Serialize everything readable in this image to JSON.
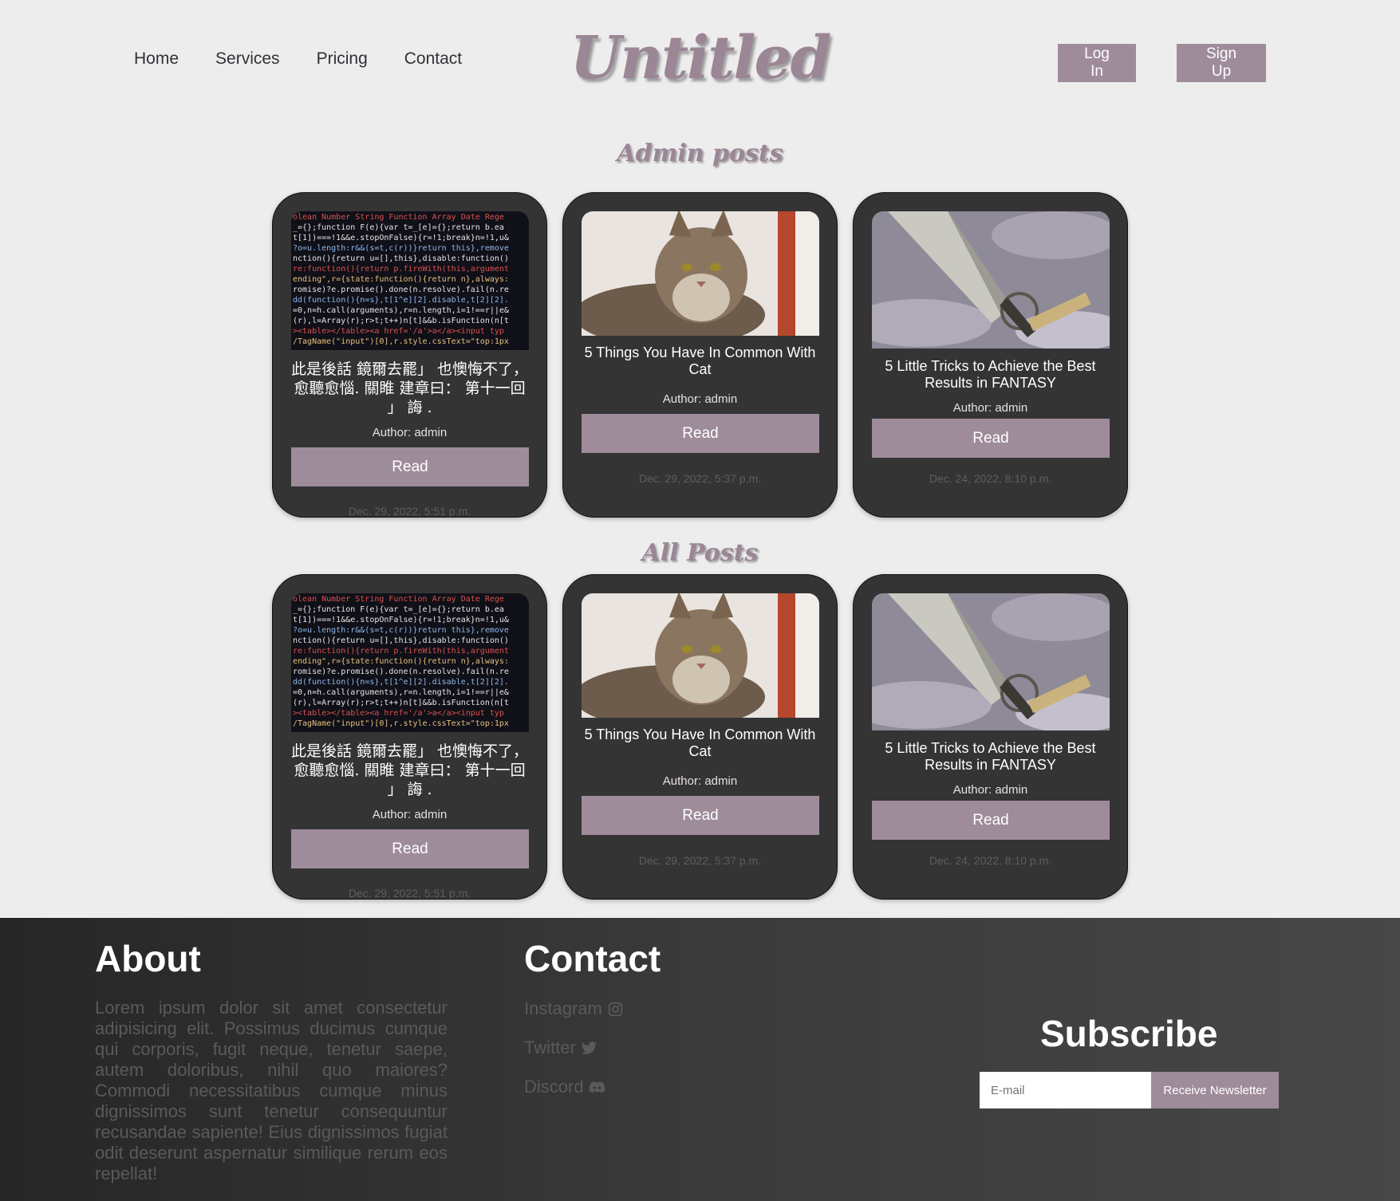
{
  "nav": {
    "home": "Home",
    "services": "Services",
    "pricing": "Pricing",
    "contact": "Contact"
  },
  "logo": "Untitled",
  "auth": {
    "login": "Log In",
    "signup": "Sign Up"
  },
  "sections": {
    "admin": "Admin posts",
    "all": "All Posts"
  },
  "posts": [
    {
      "title": "此是後話 鏡爾去罷」 也懊悔不了， 愈聽愈惱. 關睢 建章曰： 第十一回 」 誨 .",
      "author": "Author: admin",
      "read": "Read",
      "date": "Dec. 29, 2022, 5:51 p.m.",
      "image": "code-screenshot"
    },
    {
      "title": "5 Things You Have In Common With Cat",
      "author": "Author: admin",
      "read": "Read",
      "date": "Dec. 29, 2022, 5:37 p.m.",
      "image": "cat-photo"
    },
    {
      "title": "5 Little Tricks to Achieve the Best Results in FANTASY",
      "author": "Author: admin",
      "read": "Read",
      "date": "Dec. 24, 2022, 8:10 p.m.",
      "image": "sword-painting"
    }
  ],
  "footer": {
    "about_heading": "About",
    "about_text": "Lorem ipsum dolor sit amet consectetur adipisicing elit. Possimus ducimus cumque qui corporis, fugit neque, tenetur saepe, autem doloribus, nihil quo maiores? Commodi necessitatibus cumque minus dignissimos sunt tenetur consequuntur recusandae sapiente! Eius dignissimos fugiat odit deserunt aspernatur similique rerum eos repellat!",
    "contact_heading": "Contact",
    "instagram": "Instagram",
    "twitter": "Twitter",
    "discord": "Discord",
    "subscribe_heading": "Subscribe",
    "email_placeholder": "E-mail",
    "newsletter_button": "Receive Newsletter"
  },
  "colors": {
    "accent": "#9f8c9b",
    "card": "#343434",
    "background": "#eeeded"
  }
}
